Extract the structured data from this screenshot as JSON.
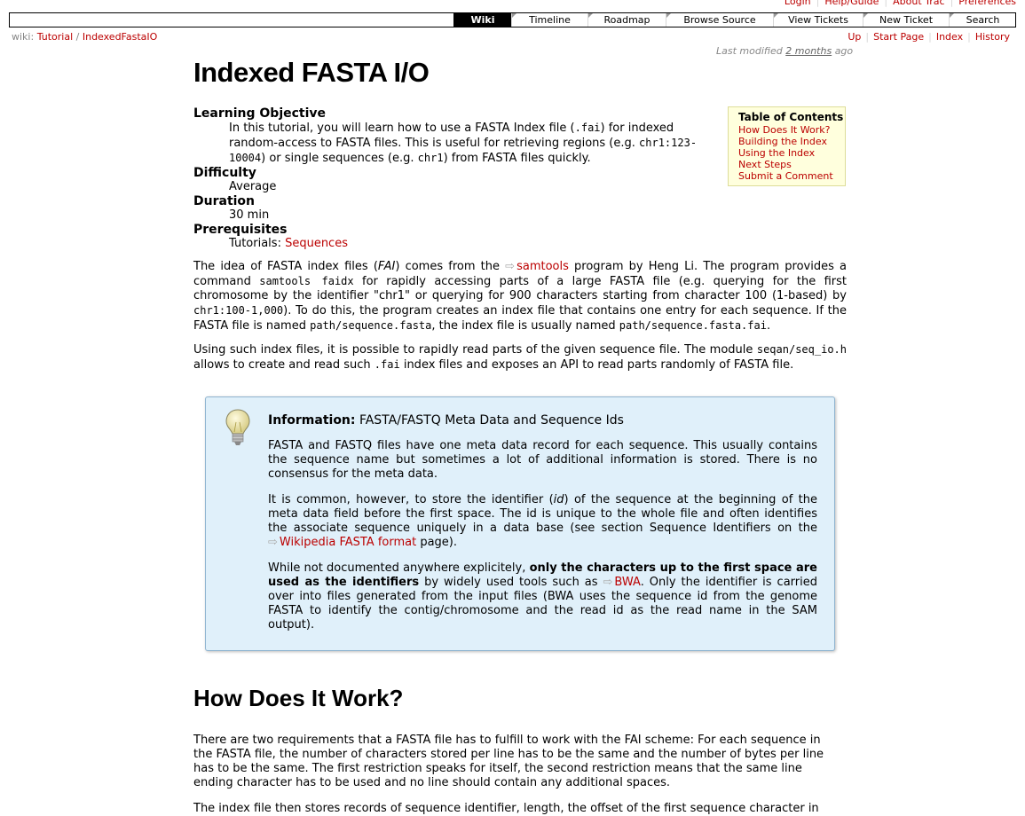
{
  "metanav": {
    "login": "Login",
    "help": "Help/Guide",
    "about": "About Trac",
    "prefs": "Preferences"
  },
  "mainnav": [
    "Wiki",
    "Timeline",
    "Roadmap",
    "Browse Source",
    "View Tickets",
    "New Ticket",
    "Search"
  ],
  "breadcrumb": {
    "prefix": "wiki:",
    "tutorial": "Tutorial",
    "sep": "/",
    "page": "IndexedFastaIO"
  },
  "ctxnav": [
    "Up",
    "Start Page",
    "Index",
    "History"
  ],
  "lastmod": {
    "label": "Last modified",
    "when": "2 months",
    "suffix": "ago"
  },
  "title": "Indexed FASTA I/O",
  "dl": {
    "lo_term": "Learning Objective",
    "lo_1": "In this tutorial, you will learn how to use a FASTA Index file (",
    "lo_code1": ".fai",
    "lo_2": ") for indexed random-access to FASTA files. This is useful for retrieving regions (e.g. ",
    "lo_code2": "chr1:123-10004",
    "lo_3": ") or single sequences (e.g. ",
    "lo_code3": "chr1",
    "lo_4": ") from FASTA files quickly.",
    "diff_term": "Difficulty",
    "diff_val": "Average",
    "dur_term": "Duration",
    "dur_val": "30 min",
    "pre_term": "Prerequisites",
    "pre_label": "Tutorials: ",
    "pre_link": "Sequences"
  },
  "toc": {
    "title": "Table of Contents",
    "items": [
      "How Does It Work?",
      "Building the Index",
      "Using the Index",
      "Next Steps",
      "Submit a Comment"
    ]
  },
  "p1": {
    "a": "The idea of FASTA index files (",
    "fai": "FAI",
    "b": ") comes from the ",
    "samtools": "samtools",
    "c": " program by Heng Li. The program provides a command ",
    "code1": "samtools faidx",
    "d": " for rapidly accessing parts of a large FASTA file (e.g. querying for the first chromosome by the identifier \"chr1\" or querying for 900 characters starting from character 100 (1-based) by ",
    "code2": "chr1:100-1,000",
    "e": "). To do this, the program creates an index file that contains one entry for each sequence. If the FASTA file is named ",
    "code3": "path/sequence.fasta",
    "f": ", the index file is usually named ",
    "code4": "path/sequence.fasta.fai",
    "g": "."
  },
  "p2": {
    "a": "Using such index files, it is possible to rapidly read parts of the given sequence file. The module ",
    "code1": "seqan/seq_io.h",
    "b": " allows to create and read such ",
    "code2": ".fai",
    "c": " index files and exposes an API to read parts randomly of FASTA file."
  },
  "info": {
    "label": "Information:",
    "heading": " FASTA/FASTQ Meta Data and Sequence Ids",
    "p1": "FASTA and FASTQ files have one meta data record for each sequence. This usually contains the sequence name but sometimes a lot of additional information is stored. There is no consensus for the meta data.",
    "p2a": "It is common, however, to store the identifier (",
    "p2id": "id",
    "p2b": ") of the sequence at the beginning of the meta data field before the first space. The id is unique to the whole file and often identifies the associate sequence uniquely in a data base (see section Sequence Identifiers on the ",
    "p2link": "Wikipedia FASTA format",
    "p2c": " page).",
    "p3a": "While not documented anywhere explicitely, ",
    "p3bold": "only the characters up to the first space are used as the identifiers",
    "p3b": " by widely used tools such as ",
    "p3link": "BWA",
    "p3c": ". Only the identifier is carried over into files generated from the input files (BWA uses the sequence id from the genome FASTA to identify the contig/chromosome and the read id as the read name in the SAM output)."
  },
  "h2": "How Does It Work?",
  "p3": "There are two requirements that a FASTA file has to fulfill to work with the FAI scheme: For each sequence in the FASTA file, the number of characters stored per line has to be the same and the number of bytes per line has to be the same. The first restriction speaks for itself, the second restriction means that the same line ending character has to be used and no line should contain any additional spaces.",
  "p4": "The index file then stores records of sequence identifier, length, the offset of the first sequence character in"
}
